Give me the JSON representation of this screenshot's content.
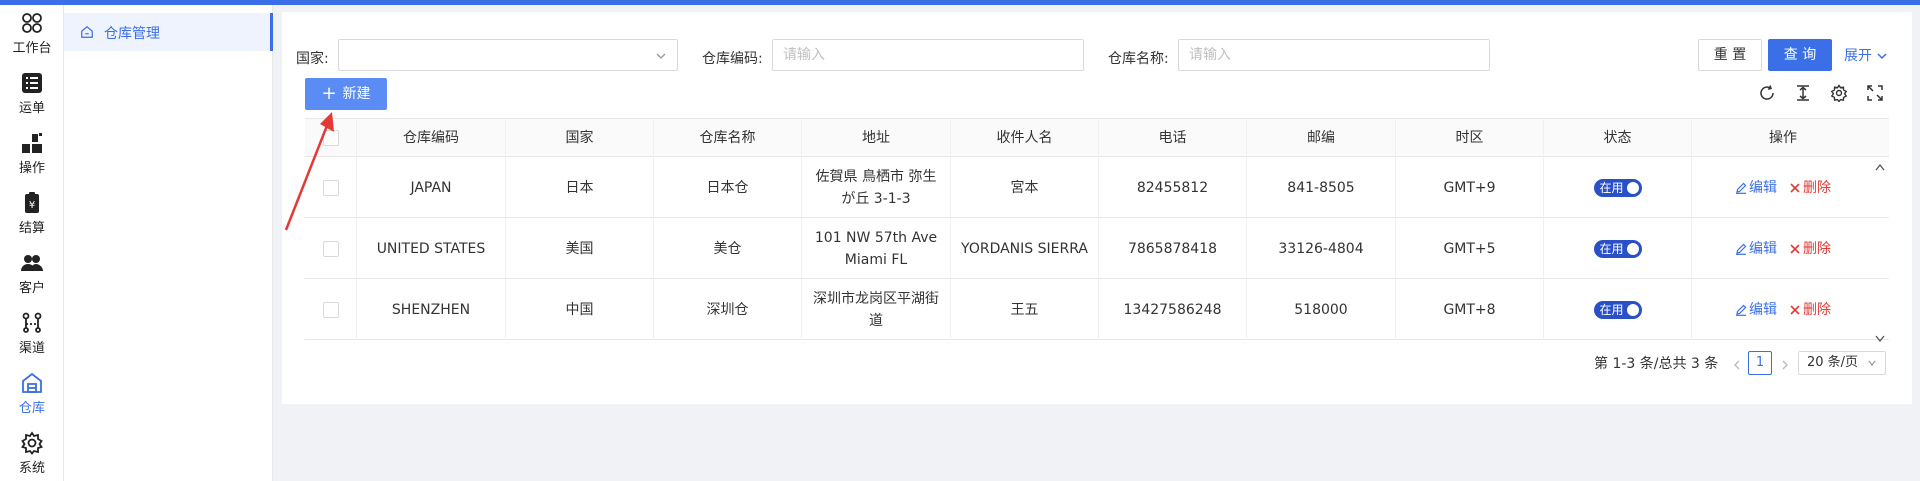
{
  "nav": {
    "items": [
      {
        "label": "工作台",
        "icon": "workbench-icon"
      },
      {
        "label": "运单",
        "icon": "waybill-icon"
      },
      {
        "label": "操作",
        "icon": "operation-icon"
      },
      {
        "label": "结算",
        "icon": "settlement-icon"
      },
      {
        "label": "客户",
        "icon": "customer-icon"
      },
      {
        "label": "渠道",
        "icon": "channel-icon"
      },
      {
        "label": "仓库",
        "icon": "warehouse-icon",
        "active": true
      },
      {
        "label": "系统",
        "icon": "settings-icon"
      }
    ]
  },
  "submenu": {
    "active_label": "仓库管理",
    "icon": "home-icon"
  },
  "filters": {
    "country_label": "国家:",
    "country_value": "",
    "code_label": "仓库编码:",
    "code_placeholder": "请输入",
    "name_label": "仓库名称:",
    "name_placeholder": "请输入"
  },
  "buttons": {
    "reset": "重 置",
    "query": "查 询",
    "expand": "展开",
    "new": "新建"
  },
  "toolbar_icons": [
    "refresh-icon",
    "column-height-icon",
    "setting-icon",
    "fullscreen-icon"
  ],
  "table": {
    "columns": [
      "仓库编码",
      "国家",
      "仓库名称",
      "地址",
      "收件人名",
      "电话",
      "邮编",
      "时区",
      "状态",
      "操作"
    ],
    "rows": [
      {
        "code": "JAPAN",
        "country": "日本",
        "name": "日本仓",
        "address": "佐賀県 鳥栖市 弥生が丘 3-1-3",
        "recipient": "宮本",
        "phone": "82455812",
        "zip": "841-8505",
        "tz": "GMT+9",
        "status": "在用"
      },
      {
        "code": "UNITED STATES",
        "country": "美国",
        "name": "美仓",
        "address": "101 NW 57th Ave Miami FL",
        "recipient": "YORDANIS SIERRA",
        "phone": "7865878418",
        "zip": "33126-4804",
        "tz": "GMT+5",
        "status": "在用"
      },
      {
        "code": "SHENZHEN",
        "country": "中国",
        "name": "深圳仓",
        "address": "深圳市龙岗区平湖街道",
        "recipient": "王五",
        "phone": "13427586248",
        "zip": "518000",
        "tz": "GMT+8",
        "status": "在用"
      }
    ],
    "edit_label": "编辑",
    "delete_label": "删除"
  },
  "pagination": {
    "summary": "第 1-3 条/总共 3 条",
    "current_page": "1",
    "page_size": "20 条/页"
  },
  "colors": {
    "primary": "#3a6fe8",
    "danger": "#e53935",
    "annotation": "#e53935"
  }
}
